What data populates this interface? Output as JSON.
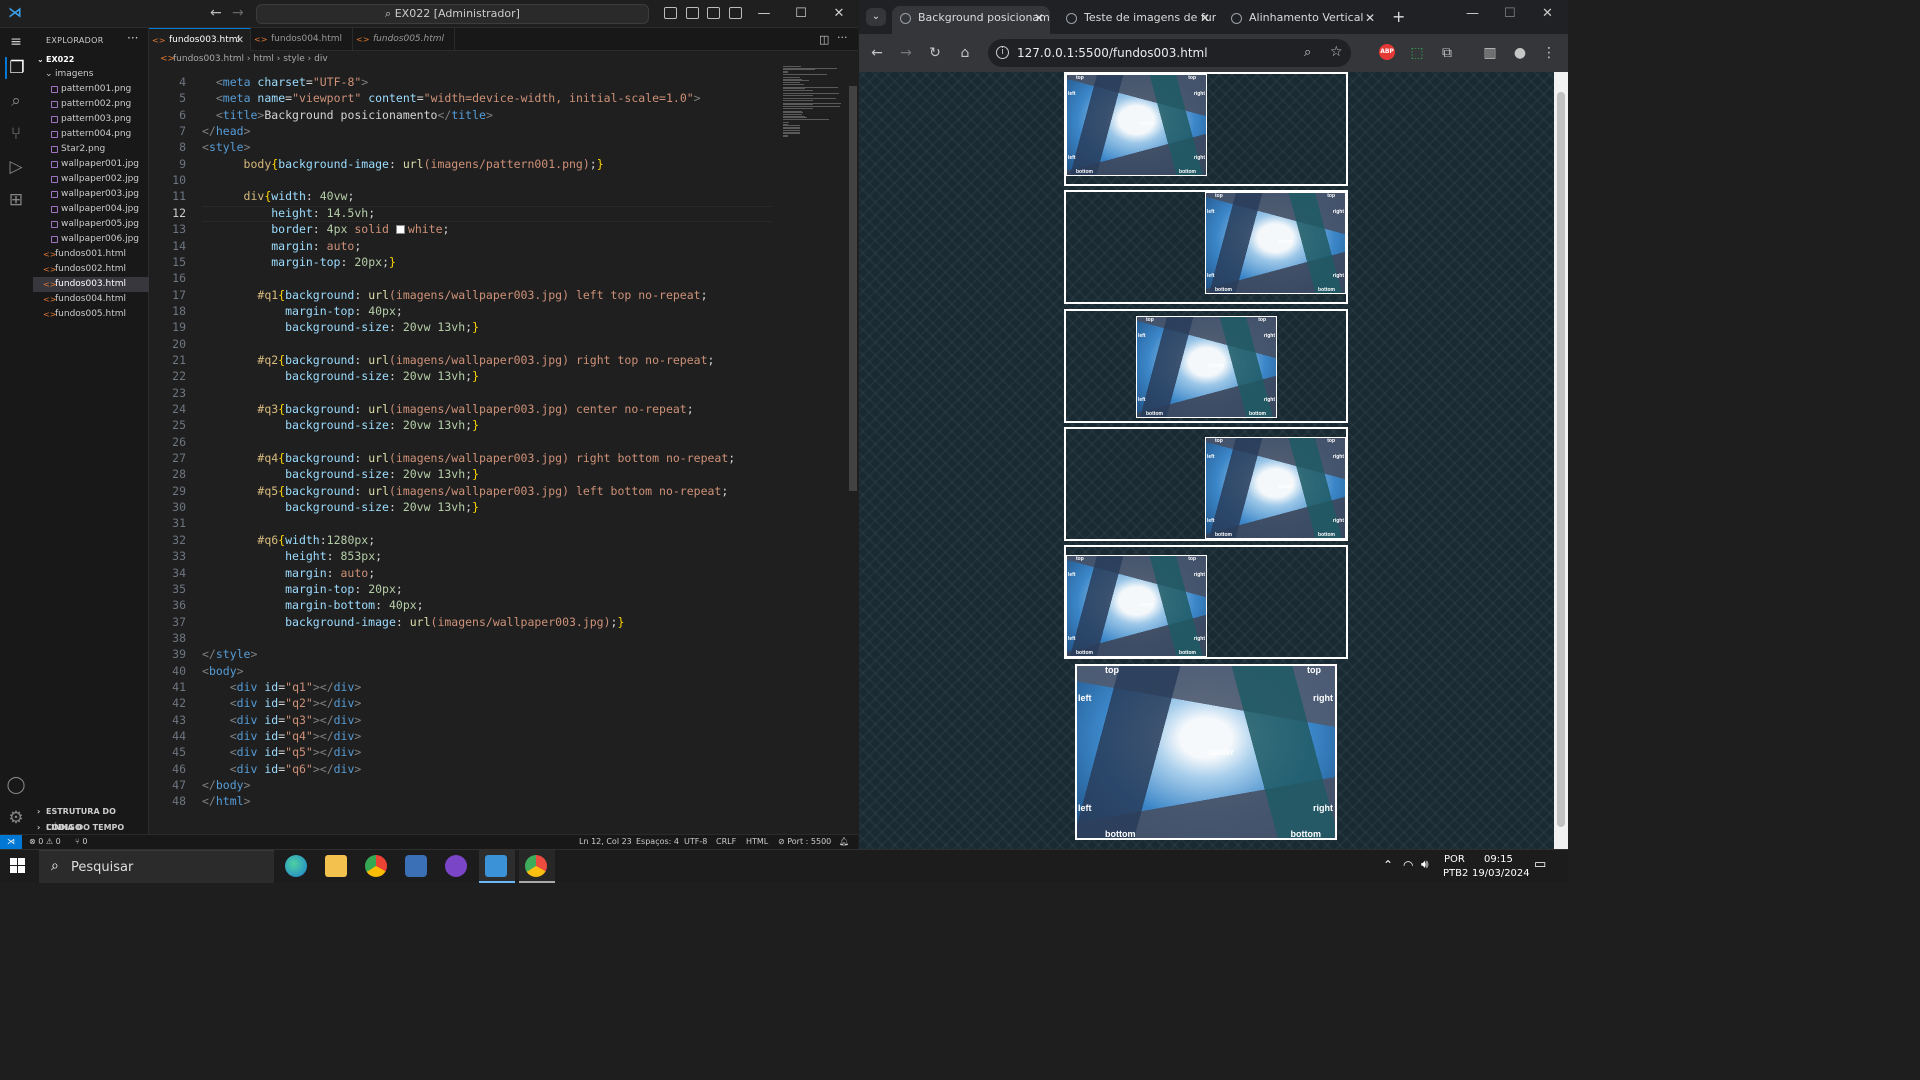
{
  "vscode": {
    "title": "EX022 [Administrador]",
    "sidebar_title": "EXPLORADOR",
    "workspace": "EX022",
    "folder": "imagens",
    "image_files": [
      "pattern001.png",
      "pattern002.png",
      "pattern003.png",
      "pattern004.png",
      "Star2.png",
      "wallpaper001.jpg",
      "wallpaper002.jpg",
      "wallpaper003.jpg",
      "wallpaper004.jpg",
      "wallpaper005.jpg",
      "wallpaper006.jpg"
    ],
    "html_files": [
      "fundos001.html",
      "fundos002.html",
      "fundos003.html",
      "fundos004.html",
      "fundos005.html"
    ],
    "sections": [
      "ESTRUTURA DO CÓDIGO",
      "LINHA DO TEMPO"
    ],
    "tabs": [
      "fundos003.html",
      "fundos004.html",
      "fundos005.html"
    ],
    "breadcrumb": [
      "fundos003.html",
      "html",
      "style",
      "div"
    ],
    "code_first_line": 4,
    "current_line": 12,
    "code": [
      [
        [
          "  ",
          "t-txt"
        ],
        [
          "<",
          "t-punct"
        ],
        [
          "meta",
          "t-tag"
        ],
        [
          " charset",
          "t-attr"
        ],
        [
          "=",
          "t-txt"
        ],
        [
          "\"UTF-8\"",
          "t-str"
        ],
        [
          ">",
          "t-punct"
        ]
      ],
      [
        [
          "  ",
          "t-txt"
        ],
        [
          "<",
          "t-punct"
        ],
        [
          "meta",
          "t-tag"
        ],
        [
          " name",
          "t-attr"
        ],
        [
          "=",
          "t-txt"
        ],
        [
          "\"viewport\"",
          "t-str"
        ],
        [
          " content",
          "t-attr"
        ],
        [
          "=",
          "t-txt"
        ],
        [
          "\"width=device-width, initial-scale=1.0\"",
          "t-str"
        ],
        [
          ">",
          "t-punct"
        ]
      ],
      [
        [
          "  ",
          "t-txt"
        ],
        [
          "<",
          "t-punct"
        ],
        [
          "title",
          "t-tag"
        ],
        [
          ">",
          "t-punct"
        ],
        [
          "Background posicionamento",
          "t-txt"
        ],
        [
          "</",
          "t-punct"
        ],
        [
          "title",
          "t-tag"
        ],
        [
          ">",
          "t-punct"
        ]
      ],
      [
        [
          "</",
          "t-punct"
        ],
        [
          "head",
          "t-tag"
        ],
        [
          ">",
          "t-punct"
        ]
      ],
      [
        [
          "<",
          "t-punct"
        ],
        [
          "style",
          "t-tag"
        ],
        [
          ">",
          "t-punct"
        ]
      ],
      [
        [
          "      ",
          "t-txt"
        ],
        [
          "body",
          "t-sel"
        ],
        [
          "{",
          "t-brace"
        ],
        [
          "background-image",
          "t-prop"
        ],
        [
          ": ",
          "t-txt"
        ],
        [
          "url",
          "t-fn"
        ],
        [
          "(imagens/pattern001.png)",
          "t-val"
        ],
        [
          ";",
          "t-txt"
        ],
        [
          "}",
          "t-brace"
        ]
      ],
      [
        [
          "",
          "t-txt"
        ]
      ],
      [
        [
          "      ",
          "t-txt"
        ],
        [
          "div",
          "t-sel"
        ],
        [
          "{",
          "t-brace"
        ],
        [
          "width",
          "t-prop"
        ],
        [
          ": ",
          "t-txt"
        ],
        [
          "40vw",
          "t-num"
        ],
        [
          ";",
          "t-txt"
        ]
      ],
      [
        [
          "          ",
          "t-txt"
        ],
        [
          "height",
          "t-prop"
        ],
        [
          ": ",
          "t-txt"
        ],
        [
          "14.5vh",
          "t-num"
        ],
        [
          ";",
          "t-txt"
        ]
      ],
      [
        [
          "          ",
          "t-txt"
        ],
        [
          "border",
          "t-prop"
        ],
        [
          ": ",
          "t-txt"
        ],
        [
          "4px",
          "t-num"
        ],
        [
          " solid ",
          "t-val"
        ],
        [
          "SWATCH",
          "t-txt"
        ],
        [
          "white",
          "t-val"
        ],
        [
          ";",
          "t-txt"
        ]
      ],
      [
        [
          "          ",
          "t-txt"
        ],
        [
          "margin",
          "t-prop"
        ],
        [
          ": ",
          "t-txt"
        ],
        [
          "auto",
          "t-val"
        ],
        [
          ";",
          "t-txt"
        ]
      ],
      [
        [
          "          ",
          "t-txt"
        ],
        [
          "margin-top",
          "t-prop"
        ],
        [
          ": ",
          "t-txt"
        ],
        [
          "20px",
          "t-num"
        ],
        [
          ";",
          "t-txt"
        ],
        [
          "}",
          "t-brace"
        ]
      ],
      [
        [
          "",
          "t-txt"
        ]
      ],
      [
        [
          "        ",
          "t-txt"
        ],
        [
          "#q1",
          "t-sel"
        ],
        [
          "{",
          "t-brace"
        ],
        [
          "background",
          "t-prop"
        ],
        [
          ": ",
          "t-txt"
        ],
        [
          "url",
          "t-fn"
        ],
        [
          "(imagens/wallpaper003.jpg)",
          "t-val"
        ],
        [
          " left top no-repeat",
          "t-val"
        ],
        [
          ";",
          "t-txt"
        ]
      ],
      [
        [
          "            ",
          "t-txt"
        ],
        [
          "margin-top",
          "t-prop"
        ],
        [
          ": ",
          "t-txt"
        ],
        [
          "40px",
          "t-num"
        ],
        [
          ";",
          "t-txt"
        ]
      ],
      [
        [
          "            ",
          "t-txt"
        ],
        [
          "background-size",
          "t-prop"
        ],
        [
          ": ",
          "t-txt"
        ],
        [
          "20vw 13vh",
          "t-num"
        ],
        [
          ";",
          "t-txt"
        ],
        [
          "}",
          "t-brace"
        ]
      ],
      [
        [
          "",
          "t-txt"
        ]
      ],
      [
        [
          "        ",
          "t-txt"
        ],
        [
          "#q2",
          "t-sel"
        ],
        [
          "{",
          "t-brace"
        ],
        [
          "background",
          "t-prop"
        ],
        [
          ": ",
          "t-txt"
        ],
        [
          "url",
          "t-fn"
        ],
        [
          "(imagens/wallpaper003.jpg)",
          "t-val"
        ],
        [
          " right top no-repeat",
          "t-val"
        ],
        [
          ";",
          "t-txt"
        ]
      ],
      [
        [
          "            ",
          "t-txt"
        ],
        [
          "background-size",
          "t-prop"
        ],
        [
          ": ",
          "t-txt"
        ],
        [
          "20vw 13vh",
          "t-num"
        ],
        [
          ";",
          "t-txt"
        ],
        [
          "}",
          "t-brace"
        ]
      ],
      [
        [
          "",
          "t-txt"
        ]
      ],
      [
        [
          "        ",
          "t-txt"
        ],
        [
          "#q3",
          "t-sel"
        ],
        [
          "{",
          "t-brace"
        ],
        [
          "background",
          "t-prop"
        ],
        [
          ": ",
          "t-txt"
        ],
        [
          "url",
          "t-fn"
        ],
        [
          "(imagens/wallpaper003.jpg)",
          "t-val"
        ],
        [
          " center no-repeat",
          "t-val"
        ],
        [
          ";",
          "t-txt"
        ]
      ],
      [
        [
          "            ",
          "t-txt"
        ],
        [
          "background-size",
          "t-prop"
        ],
        [
          ": ",
          "t-txt"
        ],
        [
          "20vw 13vh",
          "t-num"
        ],
        [
          ";",
          "t-txt"
        ],
        [
          "}",
          "t-brace"
        ]
      ],
      [
        [
          "",
          "t-txt"
        ]
      ],
      [
        [
          "        ",
          "t-txt"
        ],
        [
          "#q4",
          "t-sel"
        ],
        [
          "{",
          "t-brace"
        ],
        [
          "background",
          "t-prop"
        ],
        [
          ": ",
          "t-txt"
        ],
        [
          "url",
          "t-fn"
        ],
        [
          "(imagens/wallpaper003.jpg)",
          "t-val"
        ],
        [
          " right bottom no-repeat",
          "t-val"
        ],
        [
          ";",
          "t-txt"
        ]
      ],
      [
        [
          "            ",
          "t-txt"
        ],
        [
          "background-size",
          "t-prop"
        ],
        [
          ": ",
          "t-txt"
        ],
        [
          "20vw 13vh",
          "t-num"
        ],
        [
          ";",
          "t-txt"
        ],
        [
          "}",
          "t-brace"
        ]
      ],
      [
        [
          "        ",
          "t-txt"
        ],
        [
          "#q5",
          "t-sel"
        ],
        [
          "{",
          "t-brace"
        ],
        [
          "background",
          "t-prop"
        ],
        [
          ": ",
          "t-txt"
        ],
        [
          "url",
          "t-fn"
        ],
        [
          "(imagens/wallpaper003.jpg)",
          "t-val"
        ],
        [
          " left bottom no-repeat",
          "t-val"
        ],
        [
          ";",
          "t-txt"
        ]
      ],
      [
        [
          "            ",
          "t-txt"
        ],
        [
          "background-size",
          "t-prop"
        ],
        [
          ": ",
          "t-txt"
        ],
        [
          "20vw 13vh",
          "t-num"
        ],
        [
          ";",
          "t-txt"
        ],
        [
          "}",
          "t-brace"
        ]
      ],
      [
        [
          "",
          "t-txt"
        ]
      ],
      [
        [
          "        ",
          "t-txt"
        ],
        [
          "#q6",
          "t-sel"
        ],
        [
          "{",
          "t-brace"
        ],
        [
          "width",
          "t-prop"
        ],
        [
          ":",
          "t-txt"
        ],
        [
          "1280px",
          "t-num"
        ],
        [
          ";",
          "t-txt"
        ]
      ],
      [
        [
          "            ",
          "t-txt"
        ],
        [
          "height",
          "t-prop"
        ],
        [
          ": ",
          "t-txt"
        ],
        [
          "853px",
          "t-num"
        ],
        [
          ";",
          "t-txt"
        ]
      ],
      [
        [
          "            ",
          "t-txt"
        ],
        [
          "margin",
          "t-prop"
        ],
        [
          ": ",
          "t-txt"
        ],
        [
          "auto",
          "t-val"
        ],
        [
          ";",
          "t-txt"
        ]
      ],
      [
        [
          "            ",
          "t-txt"
        ],
        [
          "margin-top",
          "t-prop"
        ],
        [
          ": ",
          "t-txt"
        ],
        [
          "20px",
          "t-num"
        ],
        [
          ";",
          "t-txt"
        ]
      ],
      [
        [
          "            ",
          "t-txt"
        ],
        [
          "margin-bottom",
          "t-prop"
        ],
        [
          ": ",
          "t-txt"
        ],
        [
          "40px",
          "t-num"
        ],
        [
          ";",
          "t-txt"
        ]
      ],
      [
        [
          "            ",
          "t-txt"
        ],
        [
          "background-image",
          "t-prop"
        ],
        [
          ": ",
          "t-txt"
        ],
        [
          "url",
          "t-fn"
        ],
        [
          "(imagens/wallpaper003.jpg)",
          "t-val"
        ],
        [
          ";",
          "t-txt"
        ],
        [
          "}",
          "t-brace"
        ]
      ],
      [
        [
          "",
          "t-txt"
        ]
      ],
      [
        [
          "</",
          "t-punct"
        ],
        [
          "style",
          "t-tag"
        ],
        [
          ">",
          "t-punct"
        ]
      ],
      [
        [
          "<",
          "t-punct"
        ],
        [
          "body",
          "t-tag"
        ],
        [
          ">",
          "t-punct"
        ]
      ],
      [
        [
          "    ",
          "t-txt"
        ],
        [
          "<",
          "t-punct"
        ],
        [
          "div",
          "t-tag"
        ],
        [
          " id",
          "t-attr"
        ],
        [
          "=",
          "t-txt"
        ],
        [
          "\"q1\"",
          "t-str"
        ],
        [
          "></",
          "t-punct"
        ],
        [
          "div",
          "t-tag"
        ],
        [
          ">",
          "t-punct"
        ]
      ],
      [
        [
          "    ",
          "t-txt"
        ],
        [
          "<",
          "t-punct"
        ],
        [
          "div",
          "t-tag"
        ],
        [
          " id",
          "t-attr"
        ],
        [
          "=",
          "t-txt"
        ],
        [
          "\"q2\"",
          "t-str"
        ],
        [
          "></",
          "t-punct"
        ],
        [
          "div",
          "t-tag"
        ],
        [
          ">",
          "t-punct"
        ]
      ],
      [
        [
          "    ",
          "t-txt"
        ],
        [
          "<",
          "t-punct"
        ],
        [
          "div",
          "t-tag"
        ],
        [
          " id",
          "t-attr"
        ],
        [
          "=",
          "t-txt"
        ],
        [
          "\"q3\"",
          "t-str"
        ],
        [
          "></",
          "t-punct"
        ],
        [
          "div",
          "t-tag"
        ],
        [
          ">",
          "t-punct"
        ]
      ],
      [
        [
          "    ",
          "t-txt"
        ],
        [
          "<",
          "t-punct"
        ],
        [
          "div",
          "t-tag"
        ],
        [
          " id",
          "t-attr"
        ],
        [
          "=",
          "t-txt"
        ],
        [
          "\"q4\"",
          "t-str"
        ],
        [
          "></",
          "t-punct"
        ],
        [
          "div",
          "t-tag"
        ],
        [
          ">",
          "t-punct"
        ]
      ],
      [
        [
          "    ",
          "t-txt"
        ],
        [
          "<",
          "t-punct"
        ],
        [
          "div",
          "t-tag"
        ],
        [
          " id",
          "t-attr"
        ],
        [
          "=",
          "t-txt"
        ],
        [
          "\"q5\"",
          "t-str"
        ],
        [
          "></",
          "t-punct"
        ],
        [
          "div",
          "t-tag"
        ],
        [
          ">",
          "t-punct"
        ]
      ],
      [
        [
          "    ",
          "t-txt"
        ],
        [
          "<",
          "t-punct"
        ],
        [
          "div",
          "t-tag"
        ],
        [
          " id",
          "t-attr"
        ],
        [
          "=",
          "t-txt"
        ],
        [
          "\"q6\"",
          "t-str"
        ],
        [
          "></",
          "t-punct"
        ],
        [
          "div",
          "t-tag"
        ],
        [
          ">",
          "t-punct"
        ]
      ],
      [
        [
          "</",
          "t-punct"
        ],
        [
          "body",
          "t-tag"
        ],
        [
          ">",
          "t-punct"
        ]
      ],
      [
        [
          "</",
          "t-punct"
        ],
        [
          "html",
          "t-tag"
        ],
        [
          ">",
          "t-punct"
        ]
      ]
    ],
    "status": {
      "errors": "⊗ 0 ⚠ 0",
      "ports": "⑂ 0",
      "position": "Ln 12, Col 23",
      "spaces": "Espaços: 4",
      "encoding": "UTF-8",
      "eol": "CRLF",
      "language": "HTML",
      "port": "Port : 5500"
    }
  },
  "chrome": {
    "tabs": [
      "Background posicioname",
      "Teste de imagens de fun",
      "Alinhamento Vertical"
    ],
    "url": "127.0.0.1:5500/fundos003.html",
    "image_labels": {
      "top": "top",
      "left": "left",
      "right": "right",
      "center": "center",
      "bottom": "bottom"
    }
  },
  "taskbar": {
    "search_placeholder": "Pesquisar",
    "lang": "POR",
    "layout": "PTB2",
    "time": "09:15",
    "date": "19/03/2024"
  }
}
